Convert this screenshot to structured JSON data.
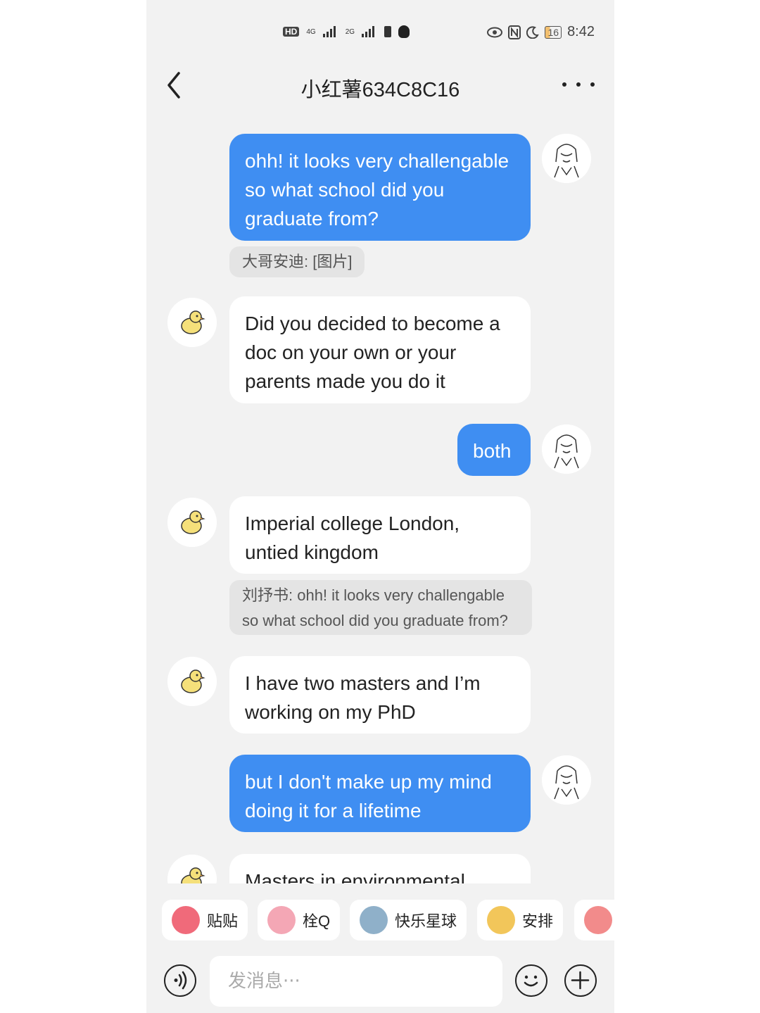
{
  "status_bar": {
    "network_left": "HD",
    "signal_1": "4G",
    "signal_2": "2G",
    "battery": "16",
    "time": "8:42"
  },
  "header": {
    "title": "小红薯634C8C16"
  },
  "messages": [
    {
      "side": "out",
      "text": "ohh! it looks very challengable so what school did you graduate from?",
      "quote": "大哥安迪: [图片]"
    },
    {
      "side": "in",
      "text": "Did you decided to become a doc on your own or your parents made you do it"
    },
    {
      "side": "out",
      "text": "both"
    },
    {
      "side": "in",
      "text": "Imperial college London, untied kingdom",
      "quote": "刘抒书: ohh! it looks very challengable so what school did you graduate from?"
    },
    {
      "side": "in",
      "text": "I have two masters and I’m working on my PhD"
    },
    {
      "side": "out",
      "text": "but I don't make up my mind doing it for a lifetime"
    },
    {
      "side": "in",
      "text": "Masters in environmental"
    }
  ],
  "quick_replies": [
    {
      "label": "贴贴",
      "color": "#f06a7a"
    },
    {
      "label": "栓Q",
      "color": "#f4a7b5"
    },
    {
      "label": "快乐星球",
      "color": "#8fb0c9"
    },
    {
      "label": "安排",
      "color": "#f2c65a"
    },
    {
      "label": "",
      "color": "#f28b8b"
    }
  ],
  "input": {
    "placeholder": "发消息···"
  },
  "icons": {
    "back": "chevron-left-icon",
    "more": "more-dots-icon",
    "voice": "voice-icon",
    "emoji": "emoji-icon",
    "plus": "plus-icon"
  },
  "colors": {
    "outgoing_bubble": "#3f8ef2",
    "incoming_bubble": "#ffffff",
    "background": "#f2f2f2"
  }
}
